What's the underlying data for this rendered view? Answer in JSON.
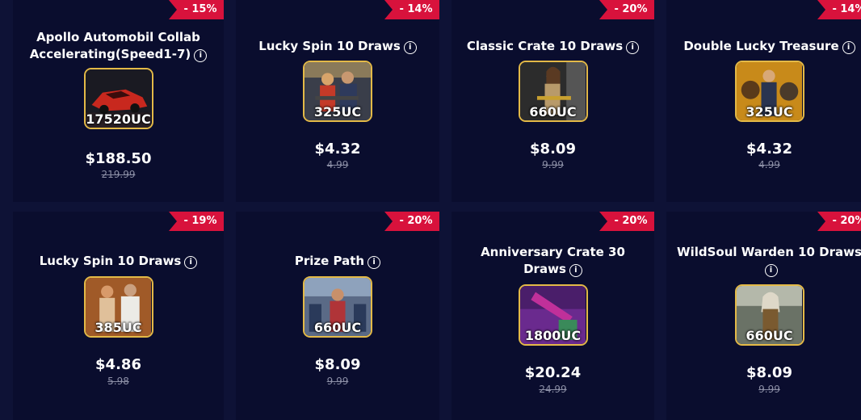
{
  "cards": [
    {
      "discount": "- 15%",
      "title": "Apollo Automobil Collab Accelerating(Speed1-7)",
      "uc": "17520UC",
      "price": "$188.50",
      "original": "219.99",
      "art": "car"
    },
    {
      "discount": "- 14%",
      "title": "Lucky Spin 10 Draws",
      "uc": "325UC",
      "price": "$4.32",
      "original": "4.99",
      "art": "spin"
    },
    {
      "discount": "- 20%",
      "title": "Classic Crate 10 Draws",
      "uc": "660UC",
      "price": "$8.09",
      "original": "9.99",
      "art": "crate"
    },
    {
      "discount": "- 14%",
      "title": "Double Lucky Treasure",
      "uc": "325UC",
      "price": "$4.32",
      "original": "4.99",
      "art": "treasure"
    },
    {
      "discount": "- 19%",
      "title": "Lucky Spin 10 Draws",
      "uc": "385UC",
      "price": "$4.86",
      "original": "5.98",
      "art": "spin2"
    },
    {
      "discount": "- 20%",
      "title": "Prize Path",
      "uc": "660UC",
      "price": "$8.09",
      "original": "9.99",
      "art": "path"
    },
    {
      "discount": "- 20%",
      "title": "Anniversary Crate 30 Draws",
      "uc": "1800UC",
      "price": "$20.24",
      "original": "24.99",
      "art": "anniv"
    },
    {
      "discount": "- 20%",
      "title": "WildSoul Warden 10 Draws",
      "uc": "660UC",
      "price": "$8.09",
      "original": "9.99",
      "art": "wild"
    }
  ],
  "info_icon_glyph": "i",
  "colors": {
    "background": "#0e1236",
    "card": "#0a0d2e",
    "badge": "#d8123c",
    "thumb_border": "#e3b947",
    "strike_text": "#8c8fa6"
  }
}
